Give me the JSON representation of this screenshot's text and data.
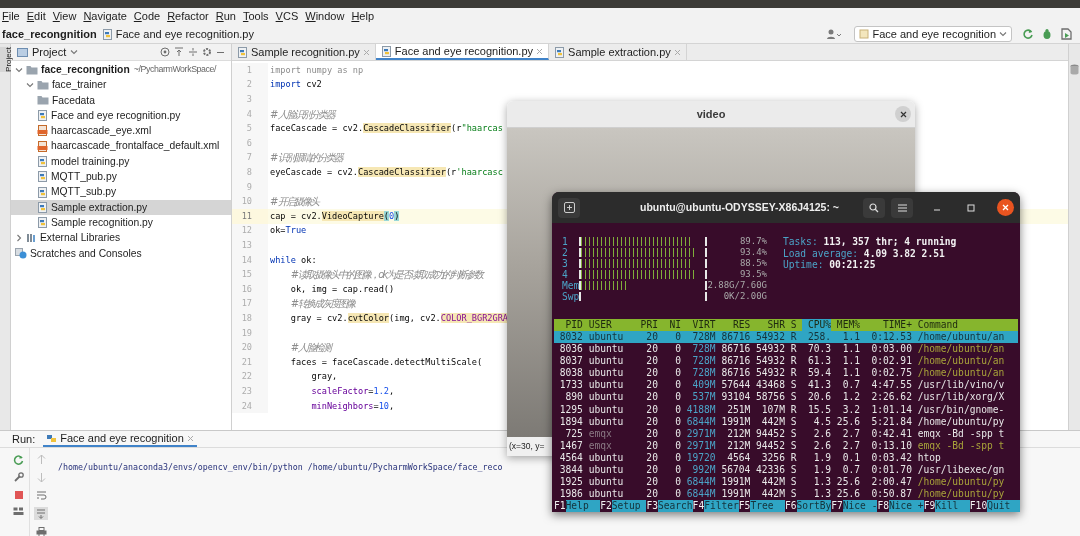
{
  "menu": [
    "File",
    "Edit",
    "View",
    "Navigate",
    "Code",
    "Refactor",
    "Run",
    "Tools",
    "VCS",
    "Window",
    "Help"
  ],
  "breadcrumb": [
    "face_recongnition",
    "Face and eye recognition.py"
  ],
  "run_config": {
    "label": "Face and eye recognition"
  },
  "project_panel": {
    "title": "Project",
    "side_label": "Project"
  },
  "project_tree": [
    {
      "label": "face_recongnition",
      "detail": "~/PycharmWorkSpace/",
      "kind": "folder",
      "expanded": true,
      "selected": false,
      "children": [
        {
          "label": "face_trainer",
          "kind": "folder",
          "expanded": true,
          "selected": false
        },
        {
          "label": "Facedata",
          "kind": "folder",
          "selected": false
        },
        {
          "label": "Face and eye recognition.py",
          "kind": "python",
          "selected": false
        },
        {
          "label": "haarcascade_eye.xml",
          "kind": "xml",
          "selected": false
        },
        {
          "label": "haarcascade_frontalface_default.xml",
          "kind": "xml",
          "selected": false
        },
        {
          "label": "model training.py",
          "kind": "python",
          "selected": false
        },
        {
          "label": "MQTT_pub.py",
          "kind": "python",
          "selected": false
        },
        {
          "label": "MQTT_sub.py",
          "kind": "python",
          "selected": false
        },
        {
          "label": "Sample extraction.py",
          "kind": "python",
          "selected": true
        },
        {
          "label": "Sample recognition.py",
          "kind": "python",
          "selected": false
        }
      ]
    },
    {
      "label": "External Libraries",
      "kind": "library",
      "expanded": false,
      "selected": false
    },
    {
      "label": "Scratches and Consoles",
      "kind": "scratches",
      "selected": false
    }
  ],
  "editor_tabs": [
    {
      "label": "Sample recognition.py",
      "selected": false
    },
    {
      "label": "Face and eye recognition.py",
      "selected": true
    },
    {
      "label": "Sample extraction.py",
      "selected": false
    }
  ],
  "code_lines": [
    {
      "number": "1",
      "current": false,
      "segments": [
        {
          "text": "import numpy as np",
          "kind": "unused"
        }
      ]
    },
    {
      "number": "2",
      "current": false,
      "segments": [
        {
          "text": "import",
          "kind": "keyword"
        },
        {
          "text": " cv2",
          "kind": "plain"
        }
      ]
    },
    {
      "number": "3",
      "current": false
    },
    {
      "number": "4",
      "current": false,
      "segments": [
        {
          "text": "# 人脸识别分类器",
          "kind": "comment"
        }
      ]
    },
    {
      "number": "5",
      "current": false,
      "segments": [
        {
          "text": "faceCascade = cv2.",
          "kind": "plain"
        },
        {
          "text": "CascadeClassifier",
          "kind": "highlight"
        },
        {
          "text": "(r",
          "kind": "plain"
        },
        {
          "text": "\"haarcas",
          "kind": "string"
        }
      ]
    },
    {
      "number": "6",
      "current": false
    },
    {
      "number": "7",
      "current": false,
      "segments": [
        {
          "text": "# 识别眼睛的分类器",
          "kind": "comment"
        }
      ]
    },
    {
      "number": "8",
      "current": false,
      "segments": [
        {
          "text": "eyeCascade = cv2.",
          "kind": "plain"
        },
        {
          "text": "CascadeClassifier",
          "kind": "highlight"
        },
        {
          "text": "(r",
          "kind": "plain"
        },
        {
          "text": "'haarcasc",
          "kind": "string"
        }
      ]
    },
    {
      "number": "9",
      "current": false
    },
    {
      "number": "10",
      "current": false,
      "segments": [
        {
          "text": "# 开启摄像头",
          "kind": "comment"
        }
      ]
    },
    {
      "number": "11",
      "current": true,
      "segments": [
        {
          "text": "cap = cv2.",
          "kind": "plain"
        },
        {
          "text": "VideoCapture",
          "kind": "highlight"
        },
        {
          "text": "(",
          "kind": "brace"
        },
        {
          "text": "0",
          "kind": "number"
        },
        {
          "text": ")",
          "kind": "brace"
        }
      ]
    },
    {
      "number": "12",
      "current": false,
      "segments": [
        {
          "text": "ok=",
          "kind": "plain"
        },
        {
          "text": "True",
          "kind": "keyword"
        }
      ]
    },
    {
      "number": "13",
      "current": false
    },
    {
      "number": "14",
      "current": false,
      "segments": [
        {
          "text": "while",
          "kind": "keyword"
        },
        {
          "text": " ok:",
          "kind": "plain"
        }
      ]
    },
    {
      "number": "15",
      "current": false,
      "segments": [
        {
          "text": "    # 读取摄像头中的图像，ok为是否读取成功的判断参数",
          "kind": "comment"
        }
      ]
    },
    {
      "number": "16",
      "current": false,
      "segments": [
        {
          "text": "    ok, img = cap.read()",
          "kind": "plain"
        }
      ]
    },
    {
      "number": "17",
      "current": false,
      "segments": [
        {
          "text": "    # 转换成灰度图像",
          "kind": "comment"
        }
      ]
    },
    {
      "number": "18",
      "current": false,
      "segments": [
        {
          "text": "    gray = cv2.",
          "kind": "plain"
        },
        {
          "text": "cvtColor",
          "kind": "highlight"
        },
        {
          "text": "(img, cv2.",
          "kind": "plain"
        },
        {
          "text": "COLOR_BGR2GRA",
          "kind": "constant"
        }
      ]
    },
    {
      "number": "19",
      "current": false
    },
    {
      "number": "20",
      "current": false,
      "segments": [
        {
          "text": "    # 人脸检测",
          "kind": "comment"
        }
      ]
    },
    {
      "number": "21",
      "current": false,
      "segments": [
        {
          "text": "    faces = faceCascade.detectMultiScale(",
          "kind": "plain"
        }
      ]
    },
    {
      "number": "22",
      "current": false,
      "segments": [
        {
          "text": "        gray,",
          "kind": "plain"
        }
      ]
    },
    {
      "number": "23",
      "current": false,
      "segments": [
        {
          "text": "        scaleFactor",
          "kind": "param"
        },
        {
          "text": "=",
          "kind": "plain"
        },
        {
          "text": "1.2",
          "kind": "number"
        },
        {
          "text": ",",
          "kind": "plain"
        }
      ]
    },
    {
      "number": "24",
      "current": false,
      "segments": [
        {
          "text": "        minNeighbors",
          "kind": "param"
        },
        {
          "text": "=",
          "kind": "plain"
        },
        {
          "text": "10",
          "kind": "number"
        },
        {
          "text": ",",
          "kind": "plain"
        }
      ]
    }
  ],
  "run_panel": {
    "label": "Run:",
    "tab": "Face and eye recognition",
    "output": "/home/ubuntu/anaconda3/envs/opencv_env/bin/python /home/ubuntu/PycharmWorkSpace/face_reco"
  },
  "video_window": {
    "title": "video",
    "status": "(x=30, y="
  },
  "terminal": {
    "title": "ubuntu@ubuntu-ODYSSEY-X86J4125: ~",
    "meters": [
      {
        "label": "1",
        "level": 0.897,
        "reading": "89.7%"
      },
      {
        "label": "2",
        "level": 0.934,
        "reading": "93.4%"
      },
      {
        "label": "3",
        "level": 0.885,
        "reading": "88.5%"
      },
      {
        "label": "4",
        "level": 0.935,
        "reading": "93.5%"
      },
      {
        "label": "Mem",
        "level": 0.38,
        "reading": "2.88G/7.60G"
      },
      {
        "label": "Swp",
        "level": 0,
        "reading": "0K/2.00G"
      }
    ],
    "stats": [
      {
        "label": "Tasks:",
        "value": "113, 357 thr; 4 running"
      },
      {
        "label": "Load average:",
        "value": "4.09 3.82 2.51"
      },
      {
        "label": "Uptime:",
        "value": "00:21:25"
      }
    ],
    "columns": [
      {
        "label": "PID",
        "sorted": false
      },
      {
        "label": "USER",
        "sorted": false
      },
      {
        "label": "PRI",
        "sorted": false
      },
      {
        "label": "NI",
        "sorted": false
      },
      {
        "label": "VIRT",
        "sorted": false
      },
      {
        "label": "RES",
        "sorted": false
      },
      {
        "label": "SHR",
        "sorted": false
      },
      {
        "label": "S",
        "sorted": false
      },
      {
        "label": "CPU%",
        "sorted": true
      },
      {
        "label": "MEM%",
        "sorted": false
      },
      {
        "label": "TIME+",
        "sorted": false
      },
      {
        "label": "Command",
        "sorted": false
      }
    ],
    "processes": [
      {
        "selected": true,
        "thread": false,
        "user_dimmed": false,
        "cells": [
          "8032",
          "ubuntu",
          "20",
          "0",
          "728M",
          "86716",
          "54932",
          "R",
          "258.",
          "1.1",
          "0:12.53",
          "/home/ubuntu/an"
        ]
      },
      {
        "selected": false,
        "thread": true,
        "user_dimmed": false,
        "cells": [
          "8036",
          "ubuntu",
          "20",
          "0",
          "728M",
          "86716",
          "54932",
          "R",
          "70.3",
          "1.1",
          "0:03.00",
          "/home/ubuntu/an"
        ]
      },
      {
        "selected": false,
        "thread": true,
        "user_dimmed": false,
        "cells": [
          "8037",
          "ubuntu",
          "20",
          "0",
          "728M",
          "86716",
          "54932",
          "R",
          "61.3",
          "1.1",
          "0:02.91",
          "/home/ubuntu/an"
        ]
      },
      {
        "selected": false,
        "thread": true,
        "user_dimmed": false,
        "cells": [
          "8038",
          "ubuntu",
          "20",
          "0",
          "728M",
          "86716",
          "54932",
          "R",
          "59.4",
          "1.1",
          "0:02.75",
          "/home/ubuntu/an"
        ]
      },
      {
        "selected": false,
        "thread": false,
        "user_dimmed": false,
        "cells": [
          "1733",
          "ubuntu",
          "20",
          "0",
          "409M",
          "57644",
          "43468",
          "S",
          "41.3",
          "0.7",
          "4:47.55",
          "/usr/lib/vino/v"
        ]
      },
      {
        "selected": false,
        "thread": false,
        "user_dimmed": false,
        "cells": [
          "890",
          "ubuntu",
          "20",
          "0",
          "537M",
          "93104",
          "58756",
          "S",
          "20.6",
          "1.2",
          "2:26.62",
          "/usr/lib/xorg/X"
        ]
      },
      {
        "selected": false,
        "thread": false,
        "user_dimmed": false,
        "cells": [
          "1295",
          "ubuntu",
          "20",
          "0",
          "4188M",
          "251M",
          "107M",
          "R",
          "15.5",
          "3.2",
          "1:01.14",
          "/usr/bin/gnome-"
        ]
      },
      {
        "selected": false,
        "thread": false,
        "user_dimmed": false,
        "cells": [
          "1894",
          "ubuntu",
          "20",
          "0",
          "6844M",
          "1991M",
          "442M",
          "S",
          "4.5",
          "25.6",
          "5:21.84",
          "/home/ubuntu/py"
        ]
      },
      {
        "selected": false,
        "thread": false,
        "user_dimmed": true,
        "cells": [
          "725",
          "emqx",
          "20",
          "0",
          "2971M",
          "212M",
          "94452",
          "S",
          "2.6",
          "2.7",
          "0:42.41",
          "emqx -Bd -spp t"
        ]
      },
      {
        "selected": false,
        "thread": true,
        "user_dimmed": true,
        "cells": [
          "1467",
          "emqx",
          "20",
          "0",
          "2971M",
          "212M",
          "94452",
          "S",
          "2.6",
          "2.7",
          "0:13.10",
          "emqx -Bd -spp t"
        ]
      },
      {
        "selected": false,
        "thread": false,
        "user_dimmed": false,
        "cells": [
          "4564",
          "ubuntu",
          "20",
          "0",
          "19720",
          "4564",
          "3256",
          "R",
          "1.9",
          "0.1",
          "0:03.42",
          "htop"
        ]
      },
      {
        "selected": false,
        "thread": false,
        "user_dimmed": false,
        "cells": [
          "3844",
          "ubuntu",
          "20",
          "0",
          "992M",
          "56704",
          "42336",
          "S",
          "1.9",
          "0.7",
          "0:01.70",
          "/usr/libexec/gn"
        ]
      },
      {
        "selected": false,
        "thread": true,
        "user_dimmed": false,
        "cells": [
          "1925",
          "ubuntu",
          "20",
          "0",
          "6844M",
          "1991M",
          "442M",
          "S",
          "1.3",
          "25.6",
          "2:00.47",
          "/home/ubuntu/py"
        ]
      },
      {
        "selected": false,
        "thread": true,
        "user_dimmed": false,
        "cells": [
          "1986",
          "ubuntu",
          "20",
          "0",
          "6844M",
          "1991M",
          "442M",
          "S",
          "1.3",
          "25.6",
          "0:50.87",
          "/home/ubuntu/py"
        ]
      }
    ],
    "function_keys": [
      {
        "key": "F1",
        "label": "Help"
      },
      {
        "key": "F2",
        "label": "Setup"
      },
      {
        "key": "F3",
        "label": "Search"
      },
      {
        "key": "F4",
        "label": "Filter"
      },
      {
        "key": "F5",
        "label": "Tree"
      },
      {
        "key": "F6",
        "label": "SortBy"
      },
      {
        "key": "F7",
        "label": "Nice -"
      },
      {
        "key": "F8",
        "label": "Nice +"
      },
      {
        "key": "F9",
        "label": "Kill"
      },
      {
        "key": "F10",
        "label": "Quit"
      }
    ]
  }
}
